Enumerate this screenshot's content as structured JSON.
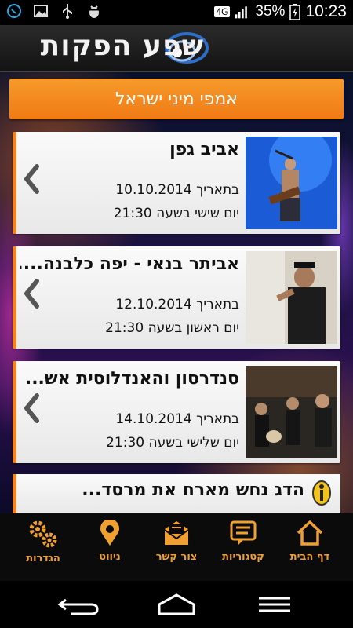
{
  "status_bar": {
    "network": "4G",
    "battery": "35%",
    "time": "10:23",
    "left_icons": [
      "whatsapp-icon",
      "image-icon",
      "usb-icon",
      "android-debug-icon"
    ]
  },
  "header": {
    "app_title": "שפע הפקות"
  },
  "category": {
    "label": "אמפי מיני ישראל"
  },
  "events": [
    {
      "title": "אביב גפן",
      "date": "בתאריך 10.10.2014",
      "time": "יום שישי בשעה 21:30"
    },
    {
      "title": "אביתר בנאי - יפה כלבנה....",
      "date": "בתאריך 12.10.2014",
      "time": "יום ראשון בשעה 21:30"
    },
    {
      "title": "סנדרסון והאנדלוסית אש...",
      "date": "בתאריך 14.10.2014",
      "time": "יום שלישי בשעה 21:30"
    }
  ],
  "promo": {
    "title": "הדג נחש מארח את מרסד..."
  },
  "bottom_nav": {
    "home": "דף הבית",
    "categories": "קטגוריות",
    "contact": "צור קשר",
    "navigate": "ניווט",
    "settings": "הגדרות"
  },
  "colors": {
    "accent": "#f58420",
    "nav_label": "#f0a030"
  }
}
